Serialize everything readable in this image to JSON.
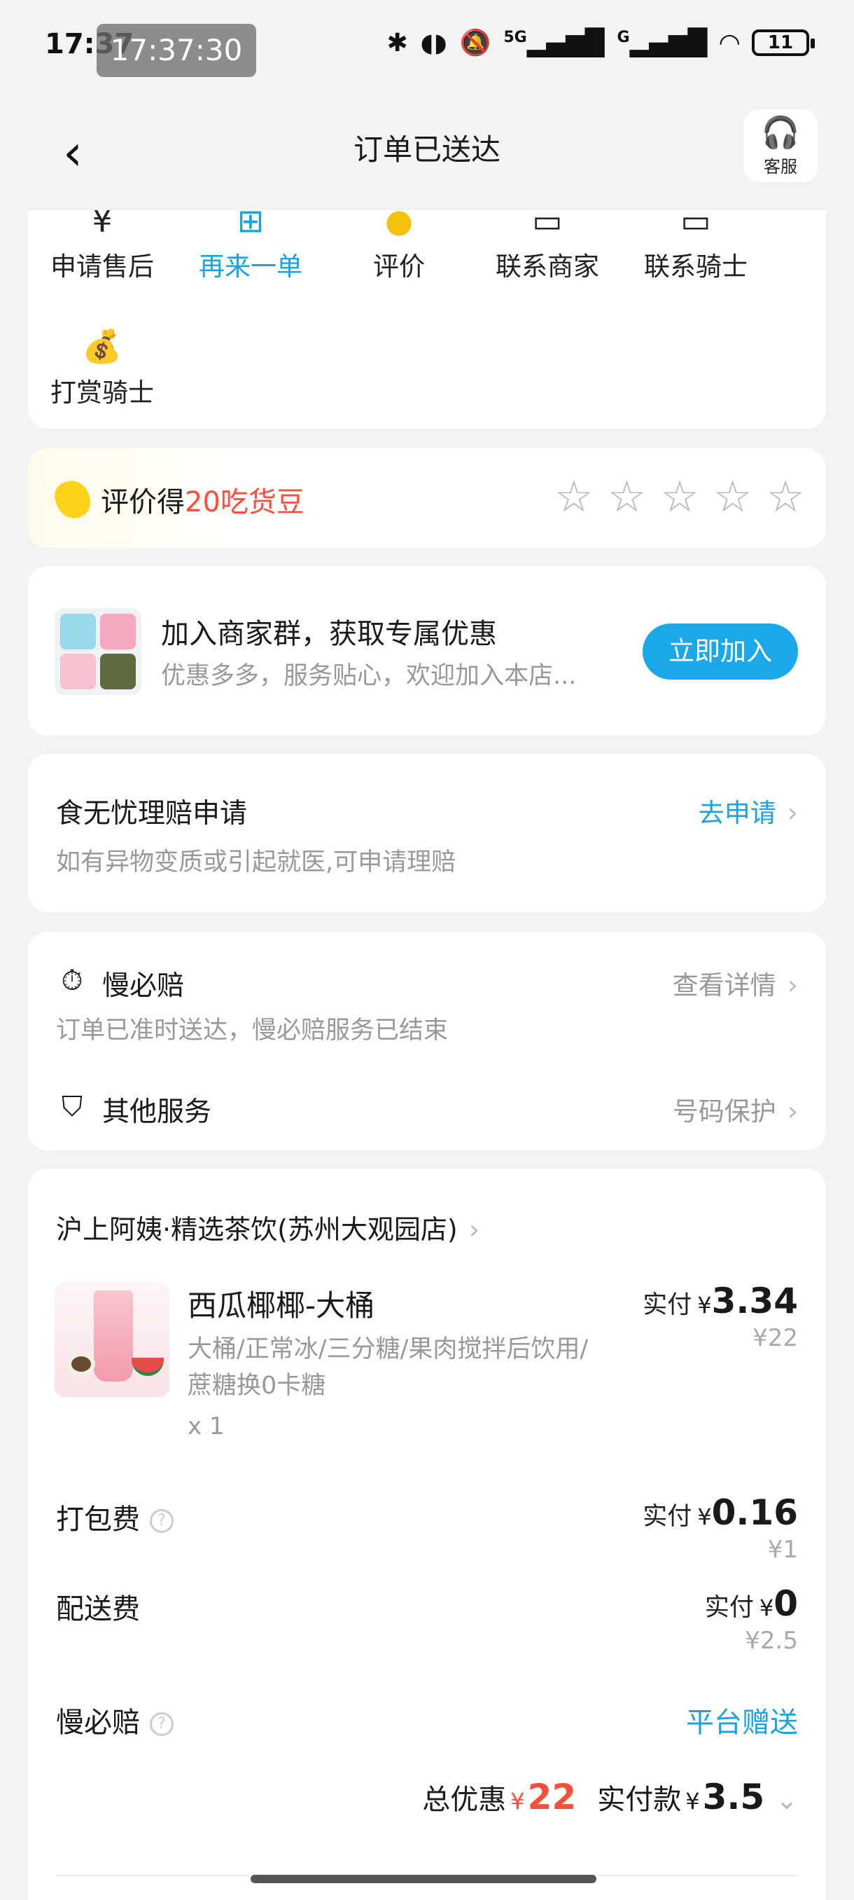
{
  "status_bar": {
    "time": "17:37",
    "screen_record_time": "17:37:30",
    "network": "5G",
    "network2": "G",
    "battery": "11"
  },
  "header": {
    "title": "订单已送达",
    "service_label": "客服"
  },
  "actions": [
    {
      "label": "申请售后",
      "icon": "yuan-icon"
    },
    {
      "label": "再来一单",
      "icon": "reorder-icon"
    },
    {
      "label": "评价",
      "icon": "bean-icon"
    },
    {
      "label": "联系商家",
      "icon": "chat-icon"
    },
    {
      "label": "联系骑士",
      "icon": "chat-icon"
    },
    {
      "label": "打赏骑士",
      "icon": "money-bag-icon"
    }
  ],
  "rating": {
    "prefix": "评价得",
    "reward": "20吃货豆",
    "stars": 5
  },
  "merchant_group": {
    "title": "加入商家群，获取专属优惠",
    "subtitle": "优惠多多，服务贴心，欢迎加入本店...",
    "button": "立即加入"
  },
  "claim": {
    "title": "食无忧理赔申请",
    "subtitle": "如有异物变质或引起就医,可申请理赔",
    "link": "去申请"
  },
  "slow_guarantee": {
    "title": "慢必赔",
    "link": "查看详情",
    "subtitle": "订单已准时送达，慢必赔服务已结束",
    "other_title": "其他服务",
    "other_link": "号码保护"
  },
  "order": {
    "shop": "沪上阿姨·精选茶饮(苏州大观园店)",
    "product": {
      "name": "西瓜椰椰-大桶",
      "spec": "大桶/正常冰/三分糖/果肉搅拌后饮用/蔗糖换0卡糖",
      "qty": "x 1",
      "paid_label": "实付",
      "currency": "¥",
      "paid": "3.34",
      "original": "¥22"
    },
    "packing": {
      "label": "打包费",
      "paid_label": "实付",
      "currency": "¥",
      "paid": "0.16",
      "original": "¥1"
    },
    "delivery": {
      "label": "配送费",
      "paid_label": "实付",
      "currency": "¥",
      "paid": "0",
      "original": "¥2.5"
    },
    "slow_pay": {
      "label": "慢必赔",
      "value": "平台赠送"
    },
    "total": {
      "discount_label": "总优惠",
      "discount_currency": "¥",
      "discount": "22",
      "paid_label": "实付款",
      "paid_currency": "¥",
      "paid": "3.5"
    }
  },
  "colors": {
    "accent_blue": "#1aa3e0",
    "highlight_red": "#ff4d3b",
    "bean_yellow": "#ffd21a"
  }
}
